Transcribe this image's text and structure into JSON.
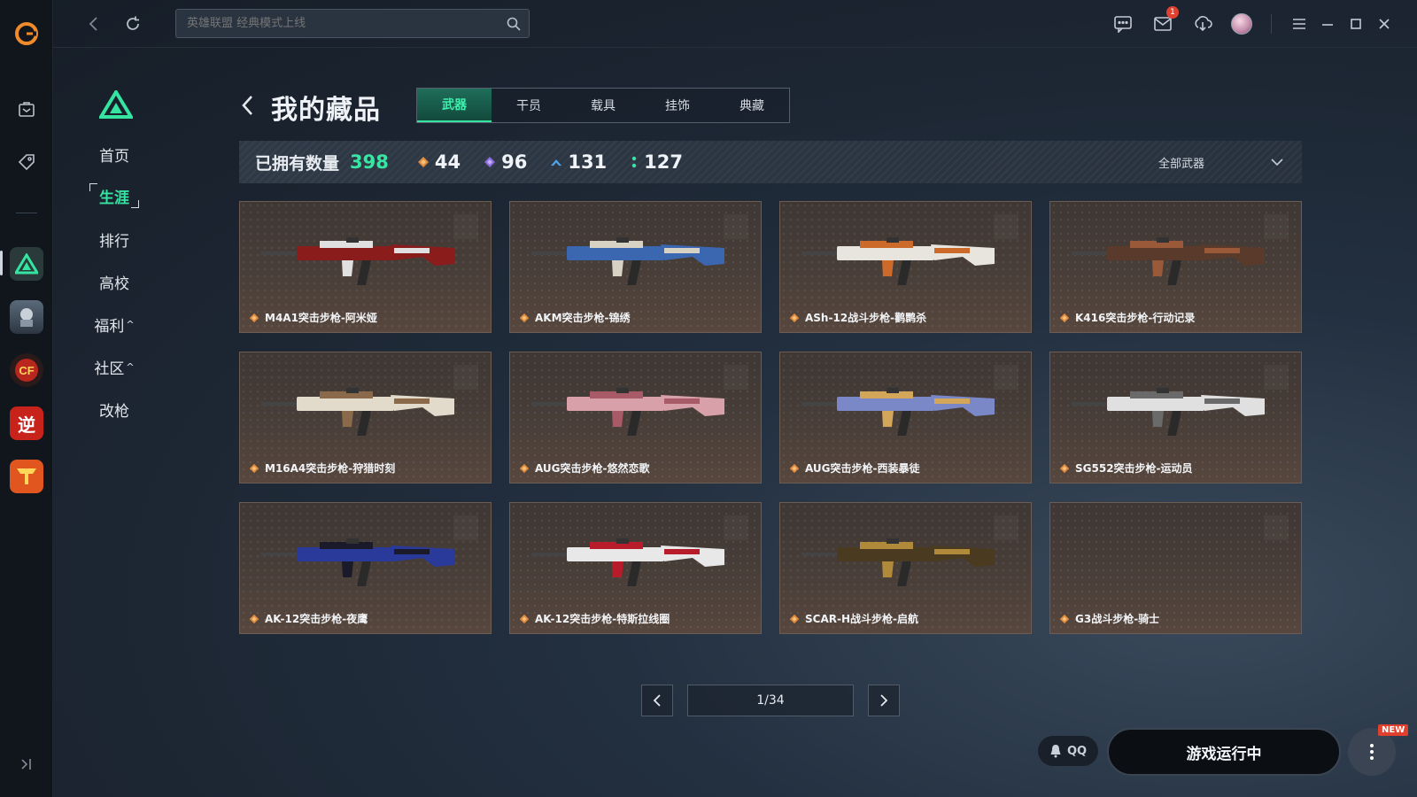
{
  "colors": {
    "accent": "#35e4a0",
    "card_bg": "#4a3f39",
    "gold_gem": "#e08a3c",
    "purple_gem": "#8a6be0",
    "blue_gem": "#4fa3e6",
    "green_gem": "#3ee0a8"
  },
  "topbar": {
    "search_placeholder": "英雄联盟 经典模式上线",
    "mail_badge": "1",
    "icons": [
      "back-icon",
      "refresh-icon",
      "search-icon",
      "chat-icon",
      "mail-icon",
      "download-icon",
      "avatar",
      "menu-icon",
      "minimize-icon",
      "maximize-icon",
      "close-icon"
    ]
  },
  "rail": {
    "items": [
      "bag-icon",
      "tag-icon",
      "delta-force-app",
      "pubg-app",
      "crossfire-app",
      "ni-app",
      "cfhd-app"
    ],
    "ni_label": "逆",
    "collapse_icon": "collapse-icon"
  },
  "nav": {
    "items": [
      {
        "label": "首页",
        "active": false
      },
      {
        "label": "生涯",
        "active": true
      },
      {
        "label": "排行",
        "active": false
      },
      {
        "label": "高校",
        "active": false
      },
      {
        "label": "福利",
        "active": false,
        "caret": "^"
      },
      {
        "label": "社区",
        "active": false,
        "caret": "^"
      },
      {
        "label": "改枪",
        "active": false
      }
    ]
  },
  "header": {
    "title": "我的藏品",
    "tabs": [
      {
        "label": "武器",
        "active": true
      },
      {
        "label": "干员",
        "active": false
      },
      {
        "label": "载具",
        "active": false
      },
      {
        "label": "挂饰",
        "active": false
      },
      {
        "label": "典藏",
        "active": false
      }
    ]
  },
  "stats": {
    "owned_label": "已拥有数量",
    "owned_count": "398",
    "tiers": [
      {
        "icon": "gold-diamond-icon",
        "value": "44"
      },
      {
        "icon": "purple-diamond-icon",
        "value": "96"
      },
      {
        "icon": "blue-chevron-icon",
        "value": "131"
      },
      {
        "icon": "green-dots-icon",
        "value": "127"
      }
    ],
    "filter_label": "全部武器"
  },
  "items": [
    {
      "name": "M4A1突击步枪-阿米娅"
    },
    {
      "name": "AKM突击步枪-锦绣"
    },
    {
      "name": "ASh-12战斗步枪-鹳鹮杀"
    },
    {
      "name": "K416突击步枪-行动记录"
    },
    {
      "name": "M16A4突击步枪-狩猎时刻"
    },
    {
      "name": "AUG突击步枪-悠然恋歌"
    },
    {
      "name": "AUG突击步枪-西装暴徒"
    },
    {
      "name": "SG552突击步枪-运动员"
    },
    {
      "name": "AK-12突击步枪-夜鹰"
    },
    {
      "name": "AK-12突击步枪-特斯拉线圈"
    },
    {
      "name": "SCAR-H战斗步枪-启航"
    },
    {
      "name": "G3战斗步枪-骑士"
    }
  ],
  "pagination": {
    "indicator": "1/34"
  },
  "footer": {
    "qq_label": "QQ",
    "run_label": "游戏运行中",
    "new_badge": "NEW"
  }
}
